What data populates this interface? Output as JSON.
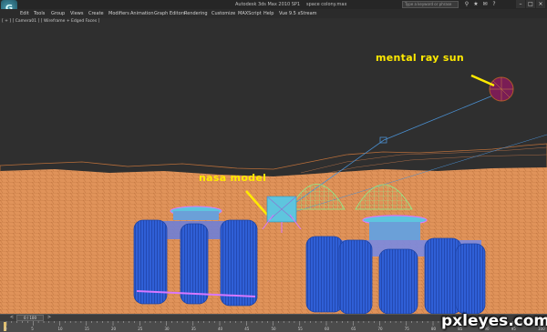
{
  "window": {
    "app_title": "Autodesk 3ds Max  2010 SP1",
    "file_name": "space colony.max",
    "search_placeholder": "Type a keyword or phrase"
  },
  "menu": [
    "Edit",
    "Tools",
    "Group",
    "Views",
    "Create",
    "Modifiers",
    "Animation",
    "Graph Editors",
    "Rendering",
    "Customize",
    "MAXScript",
    "Help",
    "Vue 9.5 xStream"
  ],
  "viewport": {
    "label": "[ + ] [ Camera01 ] [ Wireframe + Edged Faces ]",
    "scene": {
      "sky_color": "#2f2f2f",
      "ground_color": "#e0935a",
      "wire_color": "#b86e3a",
      "domes_color": "#8bf08b",
      "cylinders_color": "#2a57c8",
      "sun_color": "#8a1f5a"
    }
  },
  "annotations": {
    "sun": "mental ray sun",
    "nasa": "nasa model"
  },
  "timeline": {
    "frame_counter": "0 / 100",
    "ticks": [
      "0",
      "5",
      "10",
      "15",
      "20",
      "25",
      "30",
      "35",
      "40",
      "45",
      "50",
      "55",
      "60",
      "65",
      "70",
      "75",
      "80",
      "85",
      "90",
      "95",
      "100"
    ]
  },
  "watermark": "pxleyes.com"
}
